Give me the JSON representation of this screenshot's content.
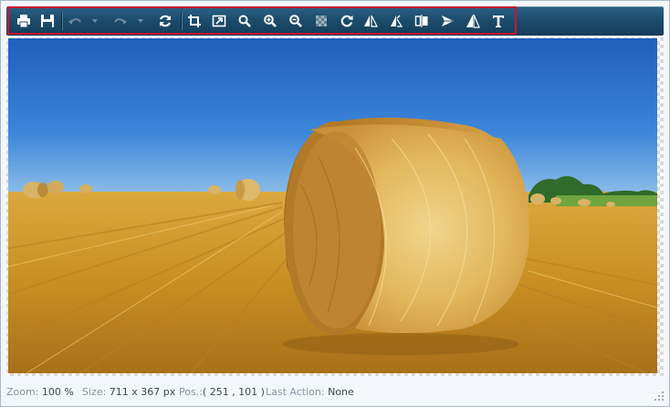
{
  "toolbar": {
    "buttons": [
      {
        "name": "print-button",
        "icon": "printer-icon"
      },
      {
        "name": "save-button",
        "icon": "floppy-disk-icon"
      },
      {
        "name": "undo-button",
        "icon": "undo-icon",
        "disabled": true
      },
      {
        "name": "redo-button",
        "icon": "redo-icon",
        "disabled": true
      },
      {
        "name": "reset-button",
        "icon": "refresh-icon"
      },
      {
        "name": "crop-button",
        "icon": "crop-icon"
      },
      {
        "name": "resize-button",
        "icon": "resize-icon"
      },
      {
        "name": "zoom-button",
        "icon": "magnifier-icon"
      },
      {
        "name": "zoom-in-button",
        "icon": "zoom-in-icon"
      },
      {
        "name": "zoom-out-button",
        "icon": "zoom-out-icon"
      },
      {
        "name": "transparency-button",
        "icon": "checkerboard-icon",
        "disabled": true
      },
      {
        "name": "rotate-button",
        "icon": "rotate-icon"
      },
      {
        "name": "flip-horizontal-button",
        "icon": "flip-horizontal-icon"
      },
      {
        "name": "flip-vertical-button",
        "icon": "flip-vertical-icon"
      },
      {
        "name": "mirror-button",
        "icon": "mirror-icon"
      },
      {
        "name": "send-button",
        "icon": "paper-plane-icon"
      },
      {
        "name": "adjust-button",
        "icon": "triangle-icon"
      },
      {
        "name": "text-button",
        "icon": "text-icon"
      }
    ],
    "accent_highlight": "#c8162d"
  },
  "status": {
    "zoom_label": "Zoom:",
    "zoom_value": "100 %",
    "size_label": "Size:",
    "size_value": "711 x 367 px",
    "pos_label": "Pos.:",
    "pos_value": "( 251 , 101 )",
    "action_label": "Last Action:",
    "action_value": "None"
  },
  "image": {
    "subject": "hay-bale-field-photo"
  }
}
